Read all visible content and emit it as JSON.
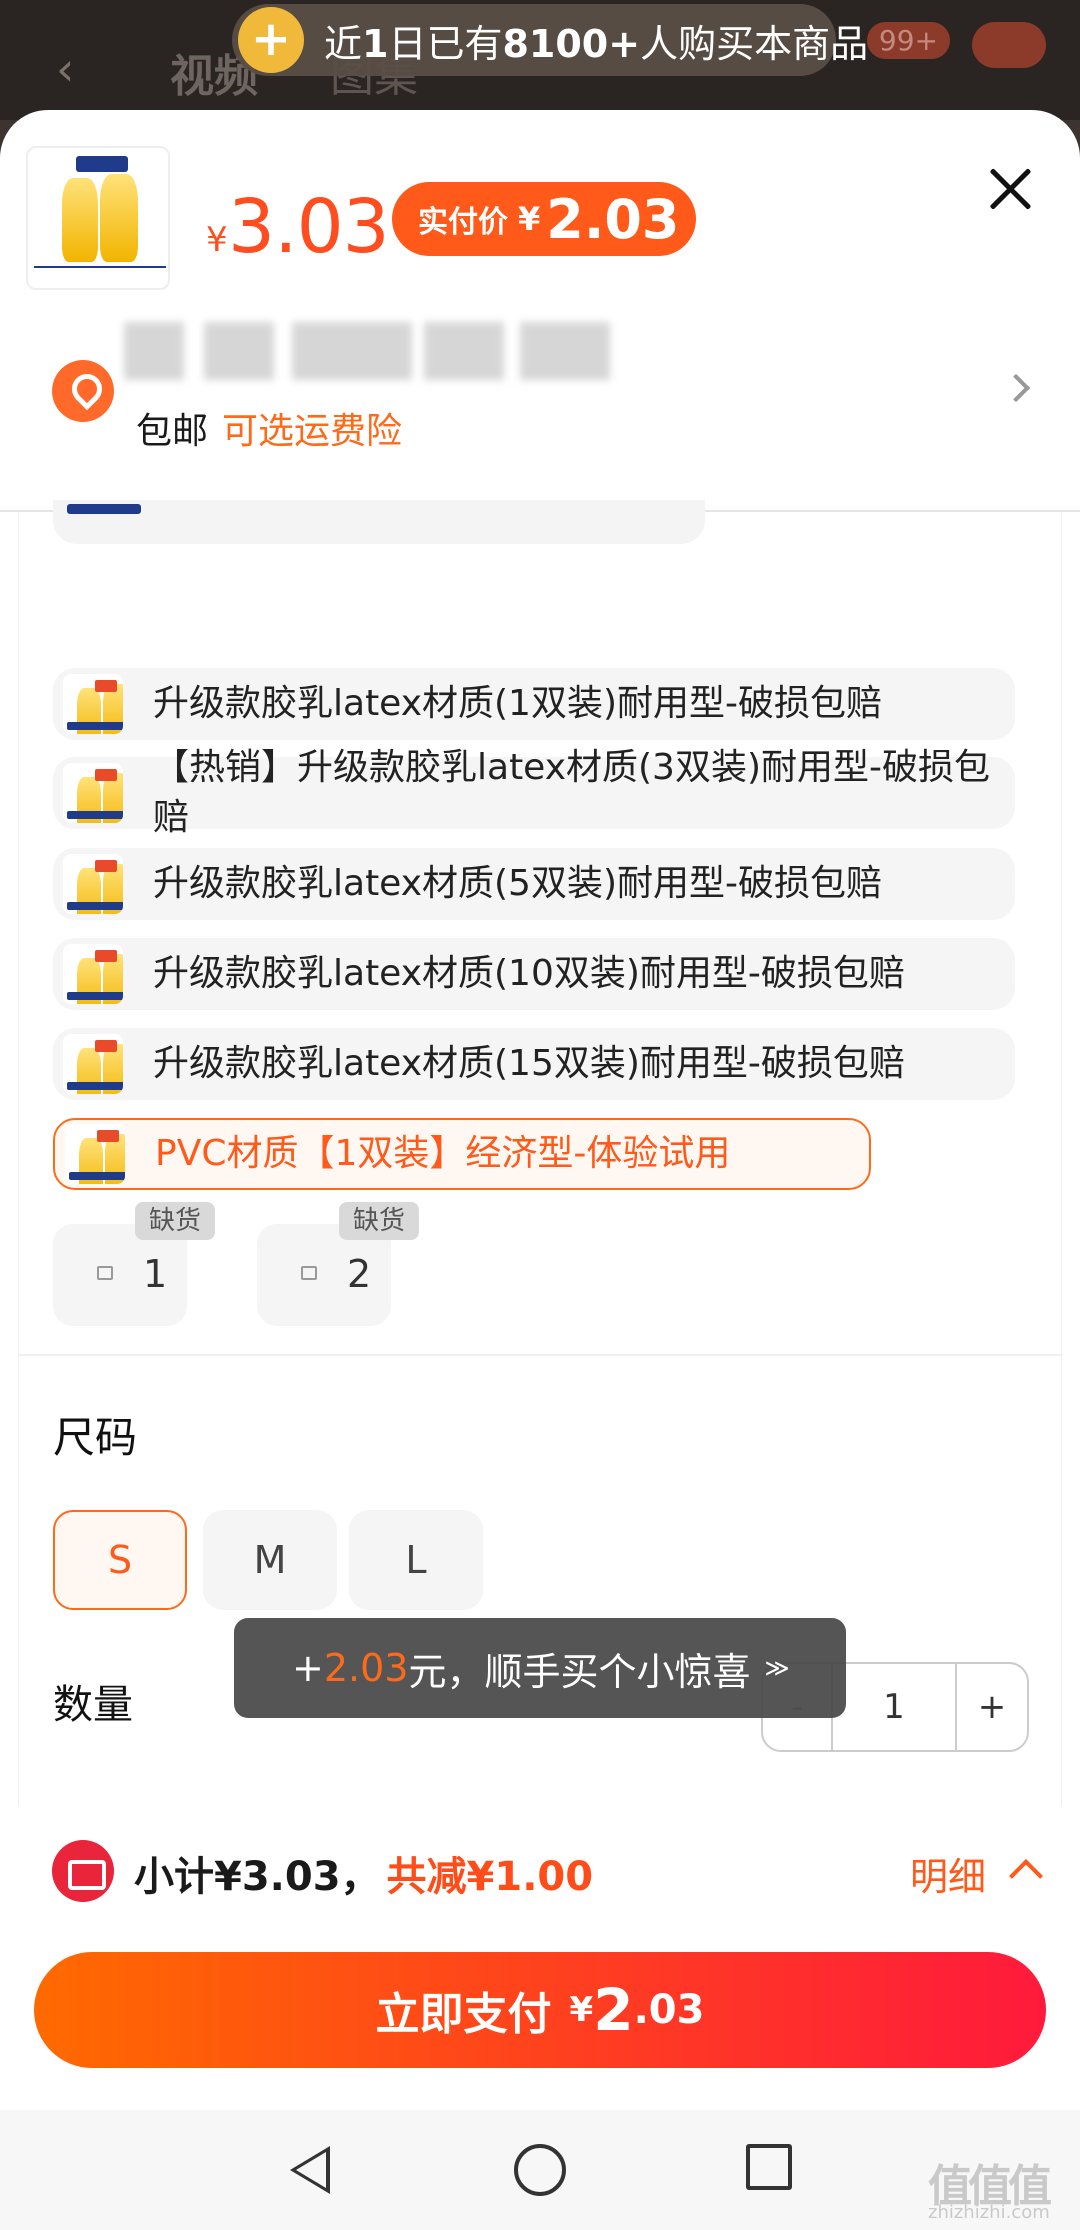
{
  "background": {
    "tabs": [
      "视频",
      "图集"
    ],
    "badge": "99+"
  },
  "banner": {
    "prefix": "近",
    "days": "1",
    "mid": "日已有",
    "count": "8100+",
    "suffix": "人购买本商品"
  },
  "header": {
    "currency_symbol": "¥",
    "price": "3.03",
    "paid_label": "实付价",
    "paid_symbol": "¥",
    "paid_price": "2.03"
  },
  "address": {
    "shipping": "包邮",
    "insurance": "可选运费险"
  },
  "options": [
    {
      "label": "升级款胶乳latex材质(1双装)耐用型-破损包赔",
      "selected": false
    },
    {
      "label": "【热销】升级款胶乳latex材质(3双装)耐用型-破损包赔",
      "selected": false
    },
    {
      "label": "升级款胶乳latex材质(5双装)耐用型-破损包赔",
      "selected": false
    },
    {
      "label": "升级款胶乳latex材质(10双装)耐用型-破损包赔",
      "selected": false
    },
    {
      "label": "升级款胶乳latex材质(15双装)耐用型-破损包赔",
      "selected": false
    },
    {
      "label": "PVC材质【1双装】经济型-体验试用",
      "selected": true
    }
  ],
  "stock_items": [
    {
      "number": "1",
      "tag": "缺货"
    },
    {
      "number": "2",
      "tag": "缺货"
    }
  ],
  "size": {
    "title": "尺码",
    "options": [
      "S",
      "M",
      "L"
    ],
    "selected": "S"
  },
  "quantity": {
    "title": "数量",
    "minus": "-",
    "value": "1",
    "plus": "+"
  },
  "toast": {
    "plus": "+",
    "amount": "2.03",
    "text": "元，顺手买个小惊喜",
    "chevron": "≫"
  },
  "summary": {
    "subtotal": "小计¥3.03，",
    "discount": "共减¥1.00",
    "detail": "明细"
  },
  "pay_button": {
    "label": "立即支付",
    "symbol": "¥",
    "amount_int": "2",
    "amount_dec": ".03"
  },
  "watermark": {
    "mark": "值值值",
    "domain": "zhizhizhi.com"
  },
  "colors": {
    "accent": "#ff5a1a",
    "price": "#ff4d1f",
    "pay_gradient_start": "#ff6a00",
    "pay_gradient_end": "#ff1a3c"
  }
}
